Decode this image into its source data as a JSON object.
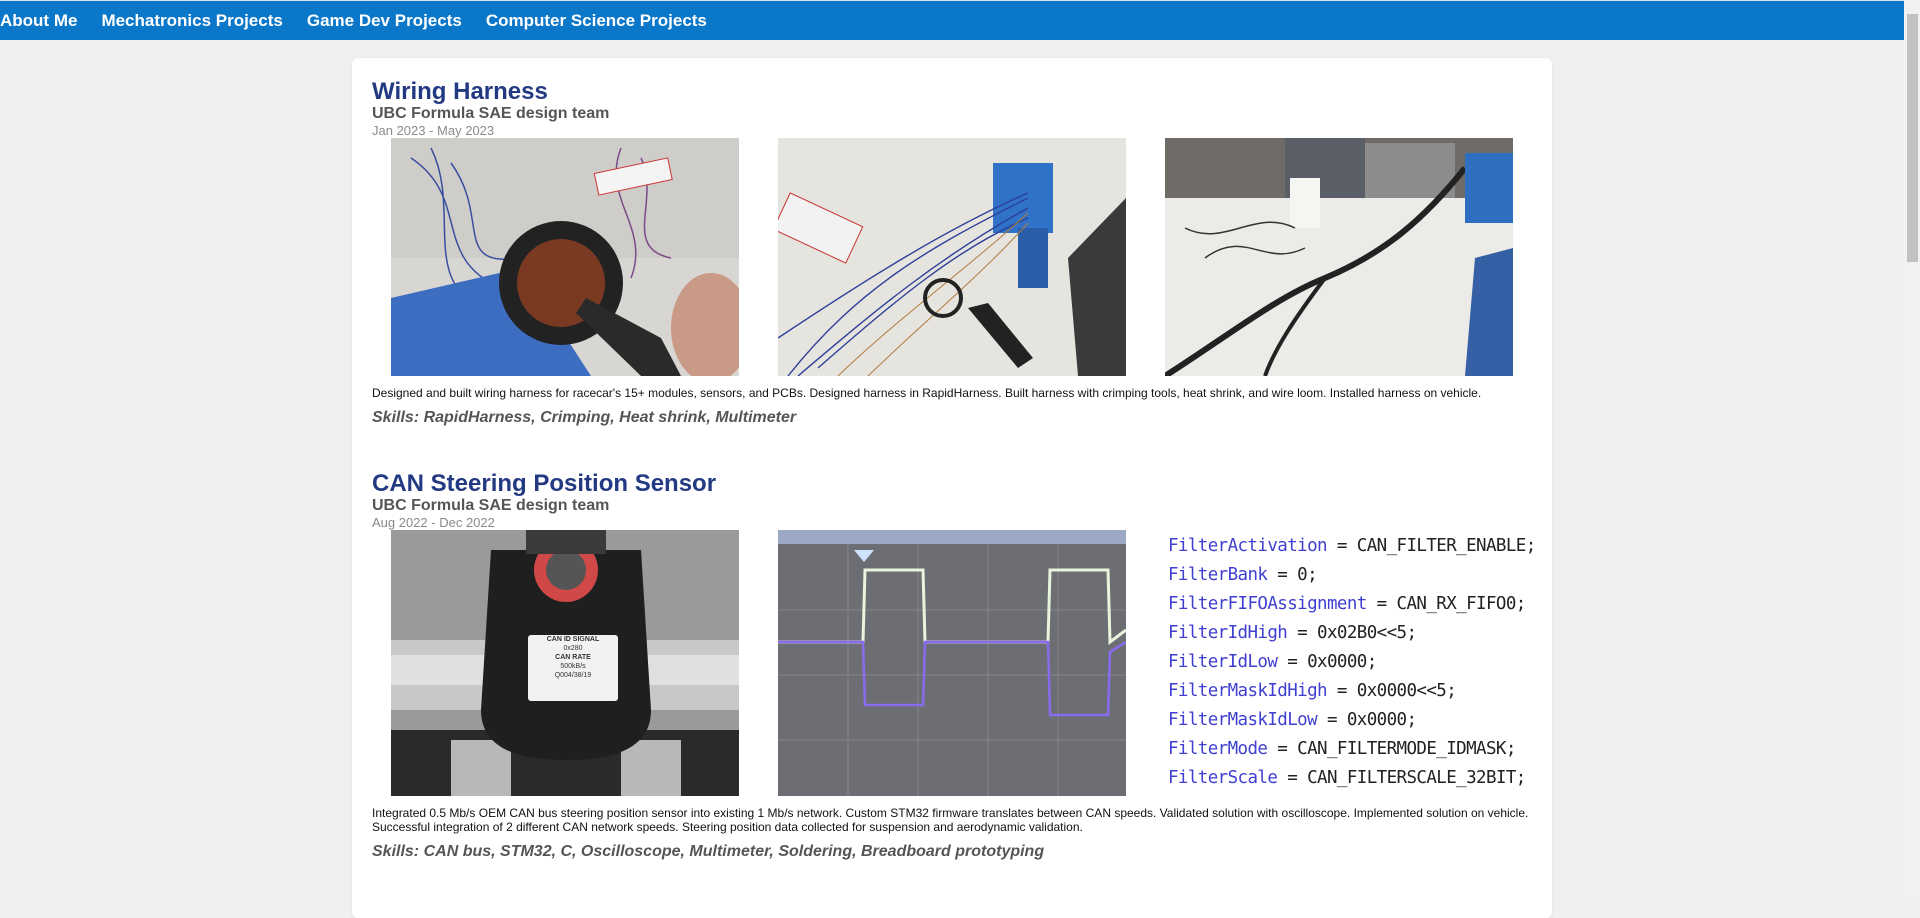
{
  "nav": {
    "items": [
      "About Me",
      "Mechatronics Projects",
      "Game Dev Projects",
      "Computer Science Projects"
    ]
  },
  "projects": [
    {
      "title": "Wiring Harness",
      "org": "UBC Formula SAE design team",
      "date": "Jan 2023 - May 2023",
      "description": "Designed and built wiring harness for racecar's 15+ modules, sensors, and PCBs. Designed harness in RapidHarness. Built harness with crimping tools, heat shrink, and wire loom. Installed harness on vehicle.",
      "skills": "Skills: RapidHarness, Crimping, Heat shrink, Multimeter"
    },
    {
      "title": "CAN Steering Position Sensor",
      "org": "UBC Formula SAE design team",
      "date": "Aug 2022 - Dec 2022",
      "description": "Integrated 0.5 Mb/s OEM CAN bus steering position sensor into existing 1 Mb/s network. Custom STM32 firmware translates between CAN speeds. Validated solution with oscilloscope. Implemented solution on vehicle. Successful integration of 2 different CAN network speeds. Steering position data collected for suspension and aerodynamic validation.",
      "skills": "Skills: CAN bus, STM32, C, Oscilloscope, Multimeter, Soldering, Breadboard prototyping",
      "sensor_label": [
        "CAN ID SIGNAL",
        "0x280",
        "CAN RATE",
        "500kB/s",
        "Q004/38/19"
      ],
      "code_lines": [
        {
          "name": "FilterActivation",
          "rest": " = CAN_FILTER_ENABLE;"
        },
        {
          "name": "FilterBank",
          "rest": " = 0;"
        },
        {
          "name": "FilterFIFOAssignment",
          "rest": " = CAN_RX_FIFO0;"
        },
        {
          "name": "FilterIdHigh",
          "rest": " = 0x02B0<<5;"
        },
        {
          "name": "FilterIdLow",
          "rest": " = 0x0000;"
        },
        {
          "name": "FilterMaskIdHigh",
          "rest": " = 0x0000<<5;"
        },
        {
          "name": "FilterMaskIdLow",
          "rest": " = 0x0000;"
        },
        {
          "name": "FilterMode",
          "rest": " = CAN_FILTERMODE_IDMASK;"
        },
        {
          "name": "FilterScale",
          "rest": " = CAN_FILTERSCALE_32BIT;"
        }
      ]
    }
  ],
  "colors": {
    "nav_bg": "#0a77c9",
    "title": "#233a83",
    "page_bg": "#f0f0f0"
  }
}
